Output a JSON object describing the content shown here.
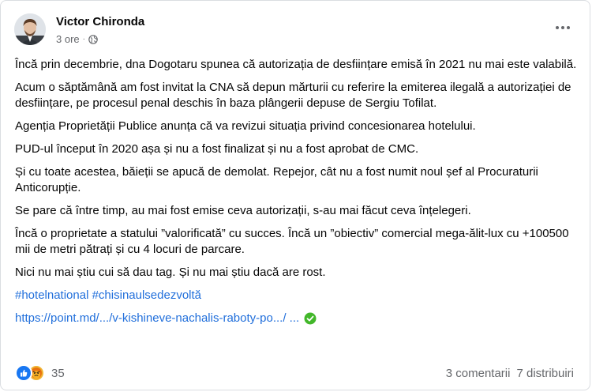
{
  "post": {
    "author": "Victor Chironda",
    "time": "3 ore",
    "dot": "·",
    "privacy_icon": "globe-icon",
    "menu_icon": "more-options-icon"
  },
  "body": {
    "paragraphs": [
      "Încă prin decembrie, dna Dogotaru spunea că autorizația de desființare emisă în 2021 nu mai este valabilă.",
      "Acum o săptămână am fost invitat la CNA să depun mărturii cu referire la emiterea ilegală a autorizației de desființare, pe procesul penal deschis în baza plângerii depuse de Sergiu Tofilat.",
      "Agenția Proprietății Publice anunța că va revizui situația privind concesionarea hotelului.",
      "PUD-ul început în 2020 așa și nu a fost finalizat și nu a fost aprobat de CMC.",
      "Și cu toate acestea, băieții se apucă de demolat. Repejor, cât nu a fost numit noul șef al Procuraturii Anticorupție.",
      "Se pare că între timp, au mai fost emise ceva autorizații, s-au mai făcut ceva înțelegeri.",
      "Încă o proprietate a statului ”valorificată” cu succes. Încă un ”obiectiv” comercial mega-ălit-lux cu +100500 mii de metri pătrați și cu 4 locuri de parcare.",
      "Nici nu mai știu cui să dau tag. Și nu mai știu dacă are rost."
    ],
    "hashtags": [
      "#hotelnational",
      "#chisinaulsedezvoltă"
    ],
    "link": "https://point.md/.../v-kishineve-nachalis-raboty-po.../ ...",
    "link_badge_icon": "verified-check-icon"
  },
  "footer": {
    "reaction_icons": [
      "like-icon",
      "angry-icon"
    ],
    "reaction_count": "35",
    "comments": "3 comentarii",
    "shares": "7 distribuiri"
  },
  "colors": {
    "link": "#216fdb",
    "secondary_text": "#65676b",
    "like_blue": "#1877f2",
    "verified_green": "#42b72a"
  }
}
